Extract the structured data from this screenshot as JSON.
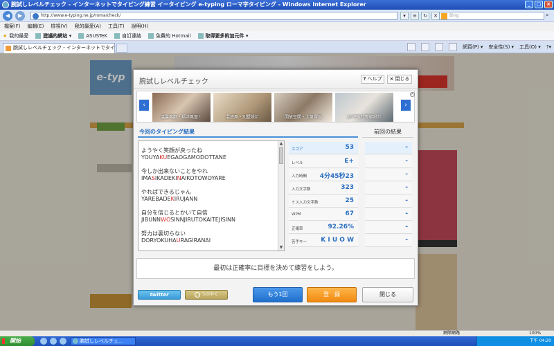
{
  "window": {
    "title": "腕試しレベルチェック - インターネットでタイピング練習 イータイピング e-typing ローマ字タイピング - Windows Internet Explorer"
  },
  "addressbar": {
    "url": "http://www.e-typing.ne.jp/roma/check/",
    "search_placeholder": "Bing"
  },
  "menu": [
    "檔案(F)",
    "編輯(E)",
    "檢視(V)",
    "我的最愛(A)",
    "工具(T)",
    "說明(H)"
  ],
  "favorites": {
    "label": "我的最愛",
    "items": [
      "建議的網站 ▾",
      "ASUSTeK",
      "自訂連結",
      "免費的 Hotmail",
      "取得更多附加元件 ▾"
    ]
  },
  "tab": {
    "title": "腕試しレベルチェック - インターネットでタイ..."
  },
  "commandbar": {
    "page": "網頁(P) ▾",
    "safety": "安全性(S) ▾",
    "tools": "工具(O) ▾"
  },
  "modal": {
    "title": "腕試しレベルチェック",
    "help_label": "ヘルプ",
    "close_label": "閉じる",
    "banner": {
      "slides": [
        {
          "caption": "溫馨客廳・福洋風室！"
        },
        {
          "caption": "混搭風・別墅設計"
        },
        {
          "caption": "開放空間・大氣得局"
        },
        {
          "caption": "20坪現代等級設計"
        }
      ]
    },
    "current_heading": "今回のタイピング結果",
    "previous_heading": "前回の結果",
    "lines": [
      {
        "jp": "ようやく笑顔が戻ったね",
        "pre": "YOUYA",
        "hl": "KU",
        "post": "EGAOGAMODOTTANE"
      },
      {
        "jp": "今しか出来ないことをやれ",
        "pre": "IMA",
        "hl": "S",
        "mid": "IKADEKI",
        "hl2": "N",
        "post": "AIKOTOWOYARE"
      },
      {
        "jp": "やればできるじゃん",
        "pre": "YAREBADE",
        "hl": "K",
        "post": "IRUJANN"
      },
      {
        "jp": "自分を信じるとかいて自信",
        "pre": "JIBUNN",
        "hl": "WO",
        "post": "SINNJIRUTOKAITEJISINN"
      },
      {
        "jp": "努力は裏切らない",
        "pre": "DORYOKUHA",
        "hl": "U",
        "post": "RAGIRANAI"
      }
    ],
    "stats": [
      {
        "label": "スコア",
        "value": "53"
      },
      {
        "label": "レベル",
        "value": "E+"
      },
      {
        "label": "入力時間",
        "value": "4分45秒23"
      },
      {
        "label": "入力文字数",
        "value": "323"
      },
      {
        "label": "ミス入力文字数",
        "value": "25"
      },
      {
        "label": "WPM",
        "value": "67"
      },
      {
        "label": "正確率",
        "value": "92.26%"
      },
      {
        "label": "苦手キー",
        "value": "K I U O W"
      }
    ],
    "previous": [
      "-",
      "-",
      "-",
      "-",
      "-",
      "-",
      "-",
      "-"
    ],
    "advice": "最初は正確率に目標を決めて練習をしよう。",
    "twitter_label": "twitter",
    "tsubuyaku_label": "つぶやく",
    "retry_label": "もう1回",
    "register_label": "登　録",
    "close_button_label": "閉じる"
  },
  "statusbar": {
    "zone": "網際網路",
    "zoom": "100%"
  },
  "taskbar": {
    "start": "開始",
    "task": "腕試しレベルチェ...",
    "clock": "下午 04:20"
  }
}
